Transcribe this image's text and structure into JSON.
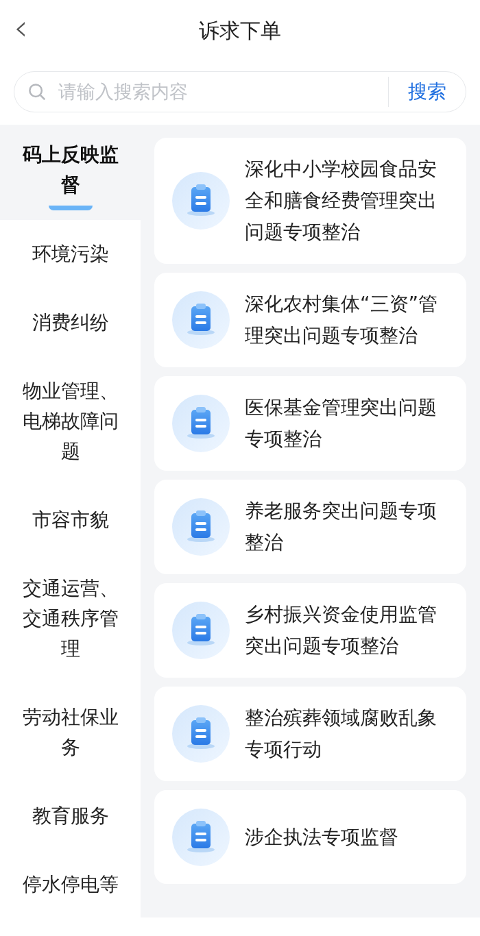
{
  "header": {
    "back": "‹",
    "title": "诉求下单"
  },
  "search": {
    "placeholder": "请输入搜索内容",
    "button": "搜索"
  },
  "categories": [
    {
      "label": "码上反映监督",
      "selected": true
    },
    {
      "label": "环境污染",
      "selected": false
    },
    {
      "label": "消费纠纷",
      "selected": false
    },
    {
      "label": "物业管理、电梯故障问题",
      "selected": false
    },
    {
      "label": "市容市貌",
      "selected": false
    },
    {
      "label": "交通运营、交通秩序管理",
      "selected": false
    },
    {
      "label": "劳动社保业务",
      "selected": false
    },
    {
      "label": "教育服务",
      "selected": false
    },
    {
      "label": "停水停电等",
      "selected": false
    }
  ],
  "items": [
    {
      "title": "深化中小学校园食品安全和膳食经费管理突出问题专项整治"
    },
    {
      "title": "深化农村集体“三资”管理突出问题专项整治"
    },
    {
      "title": "医保基金管理突出问题专项整治"
    },
    {
      "title": "养老服务突出问题专项整治"
    },
    {
      "title": "乡村振兴资金使用监管突出问题专项整治"
    },
    {
      "title": "整治殡葬领域腐败乱象专项行动"
    },
    {
      "title": "涉企执法专项监督"
    }
  ]
}
